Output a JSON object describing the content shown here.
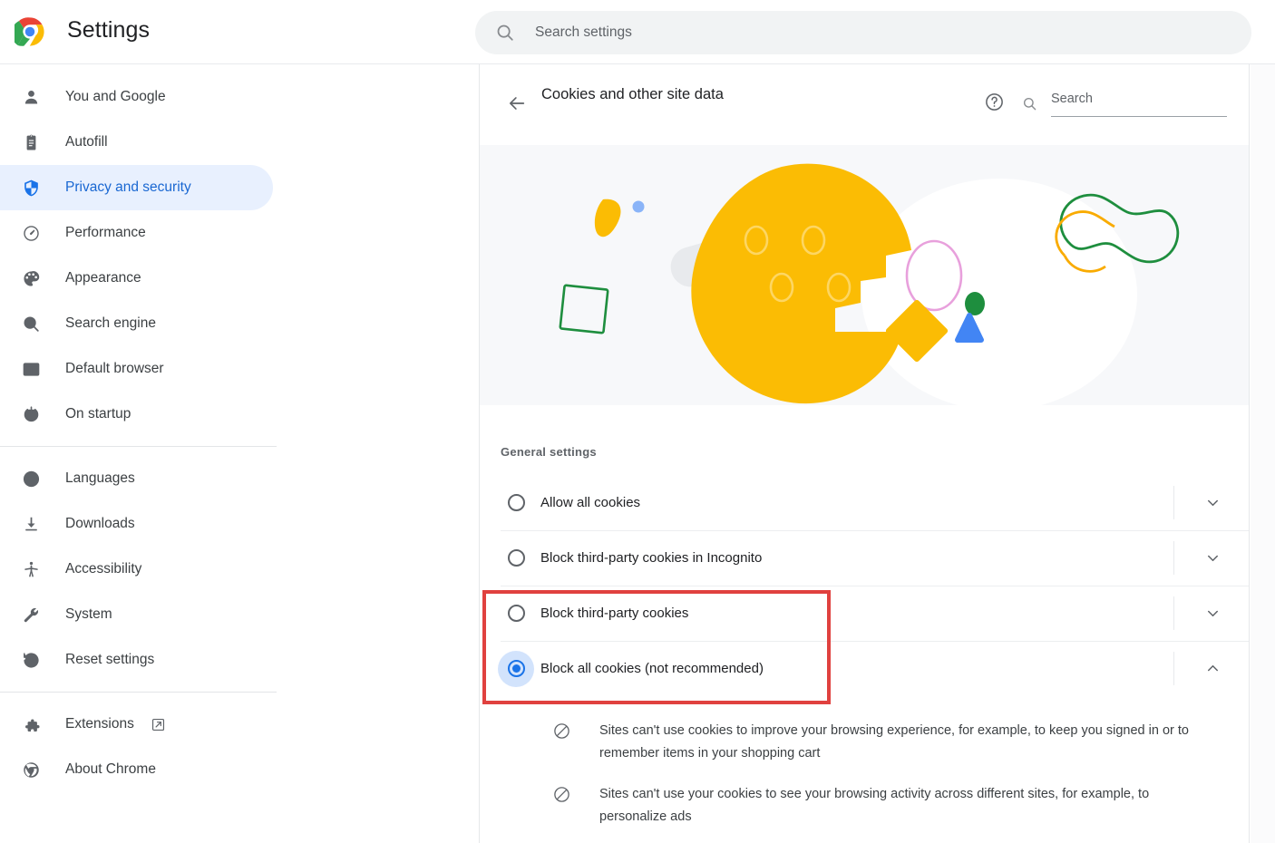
{
  "app": {
    "title": "Settings",
    "logo_icon": "chrome-logo"
  },
  "search": {
    "placeholder": "Search settings",
    "icon": "search-icon"
  },
  "sidebar": {
    "groups": [
      {
        "items": [
          {
            "label": "You and Google",
            "icon": "person-icon",
            "active": false
          },
          {
            "label": "Autofill",
            "icon": "clipboard-icon",
            "active": false
          },
          {
            "label": "Privacy and security",
            "icon": "shield-icon",
            "active": true
          },
          {
            "label": "Performance",
            "icon": "speedometer-icon",
            "active": false
          },
          {
            "label": "Appearance",
            "icon": "palette-icon",
            "active": false
          },
          {
            "label": "Search engine",
            "icon": "search-icon",
            "active": false
          },
          {
            "label": "Default browser",
            "icon": "browser-window-icon",
            "active": false
          },
          {
            "label": "On startup",
            "icon": "power-icon",
            "active": false
          }
        ]
      },
      {
        "items": [
          {
            "label": "Languages",
            "icon": "globe-icon",
            "active": false
          },
          {
            "label": "Downloads",
            "icon": "download-icon",
            "active": false
          },
          {
            "label": "Accessibility",
            "icon": "accessibility-icon",
            "active": false
          },
          {
            "label": "System",
            "icon": "wrench-icon",
            "active": false
          },
          {
            "label": "Reset settings",
            "icon": "history-icon",
            "active": false
          }
        ]
      },
      {
        "items": [
          {
            "label": "Extensions",
            "icon": "puzzle-icon",
            "active": false,
            "external": true
          },
          {
            "label": "About Chrome",
            "icon": "chrome-outline-icon",
            "active": false
          }
        ]
      }
    ]
  },
  "content": {
    "back_icon": "arrow-left-icon",
    "title": "Cookies and other site data",
    "help_icon": "help-circle-icon",
    "search": {
      "placeholder": "Search",
      "icon": "search-icon"
    },
    "illustration": {
      "name": "cookie-illustration",
      "background": "#f7f8fa",
      "cookie_color": "#fbbc04",
      "blob_color": "#ffffff",
      "shapes": [
        {
          "name": "blue-dot",
          "color": "#8ab4f8"
        },
        {
          "name": "yellow-petal",
          "color": "#fbbc04"
        },
        {
          "name": "gray-pill",
          "color": "#e8eaed"
        },
        {
          "name": "green-square-outline",
          "color": "#1e8e3e"
        },
        {
          "name": "pink-ellipse-outline",
          "color": "#e8a0dc"
        },
        {
          "name": "green-dot",
          "color": "#1e8e3e"
        },
        {
          "name": "yellow-diamond",
          "color": "#fbbc04"
        },
        {
          "name": "blue-triangle",
          "color": "#4285f4"
        },
        {
          "name": "peanut-outline-green",
          "color": "#1e8e3e"
        },
        {
          "name": "peanut-outline-yellow",
          "color": "#f9ab00"
        }
      ]
    },
    "general_settings_label": "General settings",
    "options": [
      {
        "label": "Allow all cookies",
        "selected": false,
        "expanded": false,
        "expander_icon": "chevron-down-icon"
      },
      {
        "label": "Block third-party cookies in Incognito",
        "selected": false,
        "expanded": false,
        "expander_icon": "chevron-down-icon"
      },
      {
        "label": "Block third-party cookies",
        "selected": false,
        "expanded": false,
        "expander_icon": "chevron-down-icon"
      },
      {
        "label": "Block all cookies (not recommended)",
        "selected": true,
        "expanded": true,
        "expander_icon": "chevron-up-icon"
      }
    ],
    "expanded_details": [
      {
        "icon": "block-icon",
        "text": "Sites can't use cookies to improve your browsing experience, for example, to keep you signed in or to remember items in your shopping cart"
      },
      {
        "icon": "block-icon",
        "text": "Sites can't use your cookies to see your browsing activity across different sites, for example, to personalize ads"
      }
    ]
  },
  "annotation": {
    "highlight_color": "#e0413f",
    "name": "red-highlight-box"
  }
}
